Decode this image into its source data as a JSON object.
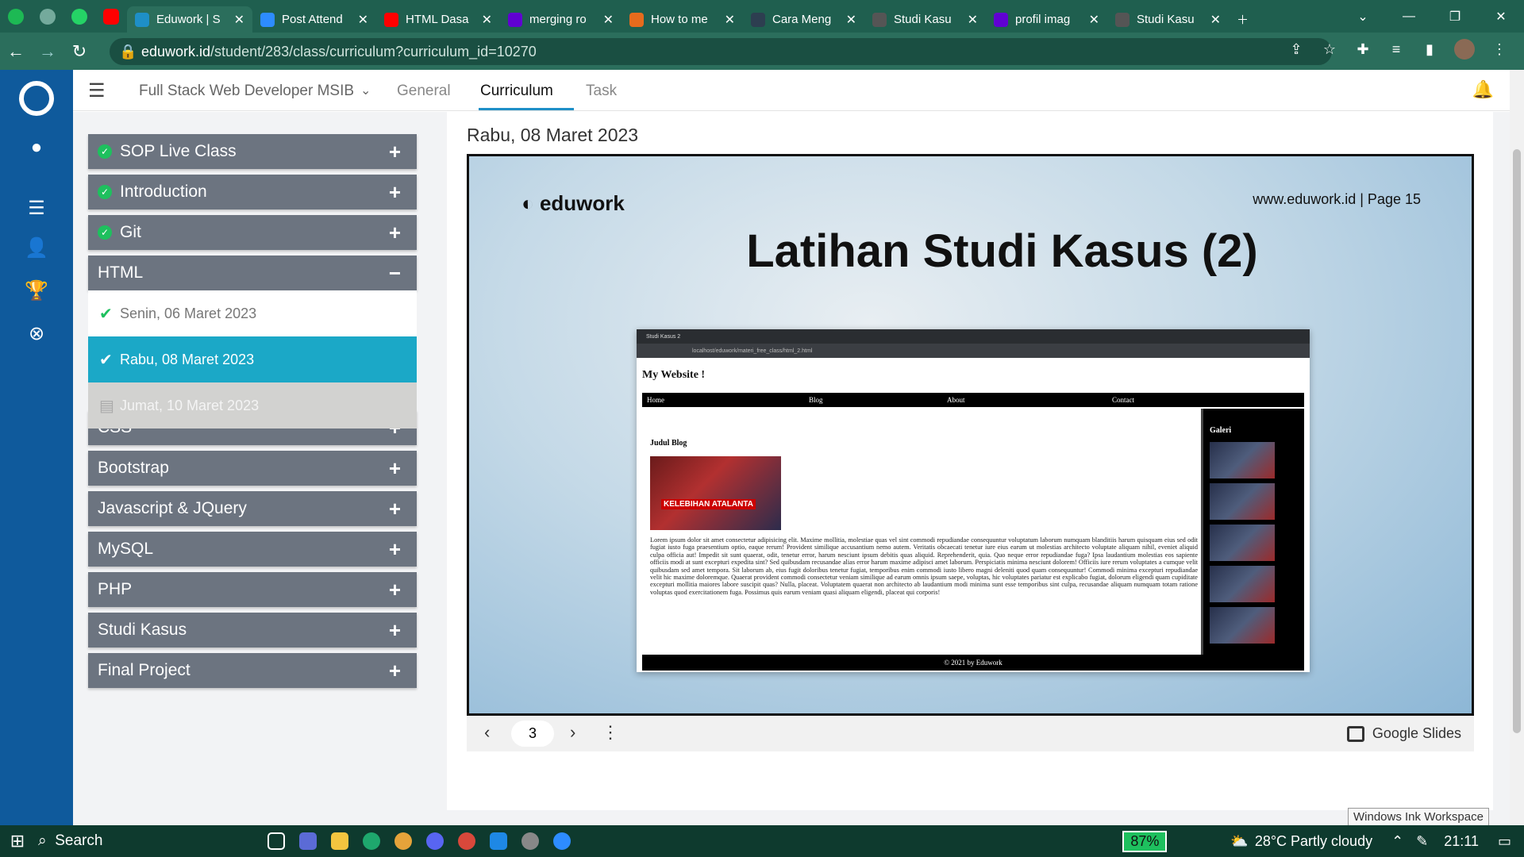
{
  "browser": {
    "tabs": [
      {
        "title": "Eduwork | S",
        "icon": "eduwork-icon",
        "color": "#1e8fc7",
        "active": true
      },
      {
        "title": "Post Attend",
        "icon": "zoom-icon",
        "color": "#2d8cff"
      },
      {
        "title": "HTML Dasa",
        "icon": "youtube-icon",
        "color": "#ff0000"
      },
      {
        "title": "merging ro",
        "icon": "yahoo-icon",
        "color": "#6001d2"
      },
      {
        "title": "How to me",
        "icon": "web-icon",
        "color": "#e66b1d"
      },
      {
        "title": "Cara Meng",
        "icon": "dicoding-icon",
        "color": "#2d3e50"
      },
      {
        "title": "Studi Kasu",
        "icon": "globe-icon",
        "color": "#555555"
      },
      {
        "title": "profil imag",
        "icon": "yahoo-icon",
        "color": "#6001d2"
      },
      {
        "title": "Studi Kasu",
        "icon": "globe-icon",
        "color": "#555555"
      }
    ],
    "url_host": "eduwork.id",
    "url_path": "/student/283/class/curriculum?curriculum_id=10270"
  },
  "header": {
    "course": "Full Stack Web Developer MSIB",
    "tabs": [
      "General",
      "Curriculum",
      "Task"
    ],
    "active_tab": "Curriculum"
  },
  "sidebar": {
    "sections": [
      {
        "label": "SOP Live Class",
        "done": true
      },
      {
        "label": "Introduction",
        "done": true
      },
      {
        "label": "Git",
        "done": true
      },
      {
        "label": "HTML",
        "done": false,
        "open": true
      },
      {
        "label": "CSS"
      },
      {
        "label": "Bootstrap"
      },
      {
        "label": "Javascript & JQuery"
      },
      {
        "label": "MySQL"
      },
      {
        "label": "PHP"
      },
      {
        "label": "Studi Kasus"
      },
      {
        "label": "Final Project"
      }
    ],
    "html_items": [
      {
        "label": "Senin, 06 Maret 2023",
        "state": "done"
      },
      {
        "label": "Rabu, 08 Maret 2023",
        "state": "active"
      },
      {
        "label": "Jumat, 10 Maret 2023",
        "state": "locked"
      }
    ]
  },
  "main": {
    "date": "Rabu, 08 Maret 2023",
    "slide": {
      "logo": "eduwork",
      "page": "www.eduwork.id | Page 15",
      "title": "Latihan Studi Kasus (2)",
      "shot": {
        "tab": "Studi Kasus 2",
        "url": "localhost/eduwork/materi_free_class/html_2.html",
        "heading": "My Website !",
        "nav": [
          "Home",
          "Blog",
          "About",
          "Contact"
        ],
        "blog_title": "Judul Blog",
        "image_caption": "KELEBIHAN ATALANTA",
        "lorem": "Lorem ipsum dolor sit amet consectetur adipisicing elit. Maxime mollitia, molestiae quas vel sint commodi repudiandae consequuntur voluptatum laborum numquam blanditiis harum quisquam eius sed odit fugiat iusto fuga praesentium optio, eaque rerum! Provident similique accusantium nemo autem. Veritatis obcaecati tenetur iure eius earum ut molestias architecto voluptate aliquam nihil, eveniet aliquid culpa officia aut! Impedit sit sunt quaerat, odit, tenetur error, harum nesciunt ipsum debitis quas aliquid. Reprehenderit, quia. Quo neque error repudiandae fuga? Ipsa laudantium molestias eos sapiente officiis modi at sunt excepturi expedita sint? Sed quibusdam recusandae alias error harum maxime adipisci amet laborum. Perspiciatis minima nesciunt dolorem! Officiis iure rerum voluptates a cumque velit quibusdam sed amet tempora. Sit laborum ab, eius fugit doloribus tenetur fugiat, temporibus enim commodi iusto libero magni deleniti quod quam consequuntur! Commodi minima excepturi repudiandae velit hic maxime doloremque. Quaerat provident commodi consectetur veniam similique ad earum omnis ipsum saepe, voluptas, hic voluptates pariatur est explicabo fugiat, dolorum eligendi quam cupiditate excepturi mollitia maiores labore suscipit quas? Nulla, placeat. Voluptatem quaerat non architecto ab laudantium modi minima sunt esse temporibus sint culpa, recusandae aliquam numquam totam ratione voluptas quod exercitationem fuga. Possimus quis earum veniam quasi aliquam eligendi, placeat qui corporis!",
        "gallery_title": "Galeri",
        "footer": "© 2021 by Eduwork"
      }
    },
    "controls": {
      "page": "3",
      "provider": "Google Slides"
    }
  },
  "tooltip": "Windows Ink Workspace",
  "taskbar": {
    "search": "Search",
    "battery": "87%",
    "weather": "28°C  Partly cloudy",
    "time": "21:11"
  }
}
